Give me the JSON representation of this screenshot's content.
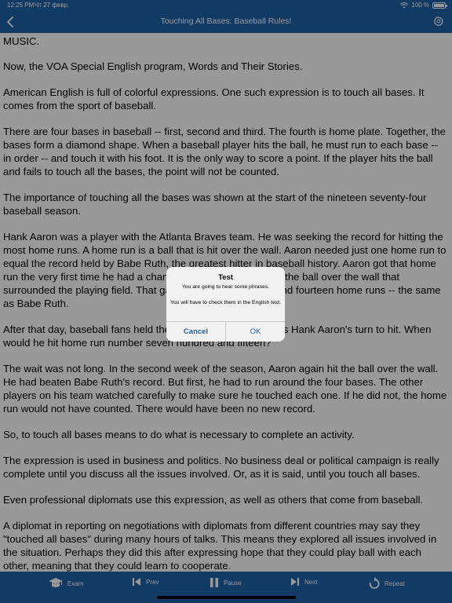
{
  "status_bar": {
    "time": "12:25 PM",
    "date": "Чт 27 февр.",
    "battery_percent": "100 %",
    "wifi_icon": "wifi-icon",
    "battery_icon": "battery-icon"
  },
  "nav": {
    "title": "Touching All Bases: Baseball Rules!",
    "back_icon": "chevron-left-icon",
    "settings_icon": "gear-icon"
  },
  "article": {
    "paragraphs": [
      "MUSIC.",
      "Now, the VOA Special English program, Words and Their Stories.",
      "American English is full of colorful expressions. One such expression is to touch all bases. It comes from the sport of baseball.",
      "There are four bases in baseball -- first, second and third. The fourth is home plate. Together, the bases form a diamond shape. When a baseball player hits the ball, he must run to each base -- in order -- and touch it with his foot. It is the only way to score a point. If the player hits the ball and fails to touch all the bases, the point will not be counted.",
      "The importance of touching all the bases was shown at the start of the nineteen seventy-four baseball season.",
      "Hank Aaron was a player with the Atlanta Braves team. He was seeking the record for hitting the most home runs. A home run is a ball that is hit over the wall. Aaron needed just one home run to equal the record held by Babe Ruth, the greatest hitter in baseball history. Aaron got that home run the very first time he had a chance to hit the ball. He sent the ball over the wall that surrounded the playing field. That gave him seven hundred and fourteen home runs -- the same as Babe Ruth.",
      "After that day, baseball fans held their breath every time it was Hank Aaron's turn to hit. When would he hit home run number seven hundred and fifteen?",
      "The wait was not long. In the second week of the season, Aaron again hit the ball over the wall. He had beaten Babe Ruth's record. But first, he had to run around the four bases. The other players on his team watched carefully to make sure he touched each one. If he did not, the home run would not have counted. There would have been no new record.",
      "So, to touch all bases means to do what is necessary to complete an activity.",
      "The expression is used in business and politics. No business deal or political campaign is really complete until you discuss all the issues involved. Or, as it is said, until you touch all bases.",
      "Even professional diplomats use this expression, as well as others that come from baseball.",
      "A diplomat in reporting on negotiations with diplomats from different countries may say they \"touched all bases\" during many hours of talks. This means they explored all issues involved in the situation. Perhaps they did this after expressing hope that they could play ball with each other, meaning that they could learn to cooperate."
    ]
  },
  "dialog": {
    "title": "Test",
    "message_line1": "You are going to hear some phrases.",
    "message_line2": "You will have to check them in the English text.",
    "cancel_label": "Cancel",
    "ok_label": "OK"
  },
  "toolbar": {
    "exam_label": "Exam",
    "prev_label": "Prev",
    "pause_label": "Pause",
    "next_label": "Next",
    "repeat_label": "Repeat"
  },
  "colors": {
    "brand_blue": "#1d62a8",
    "dialog_bg": "#f2f2f2",
    "dim_overlay": "rgba(0,0,0,0.4)"
  }
}
